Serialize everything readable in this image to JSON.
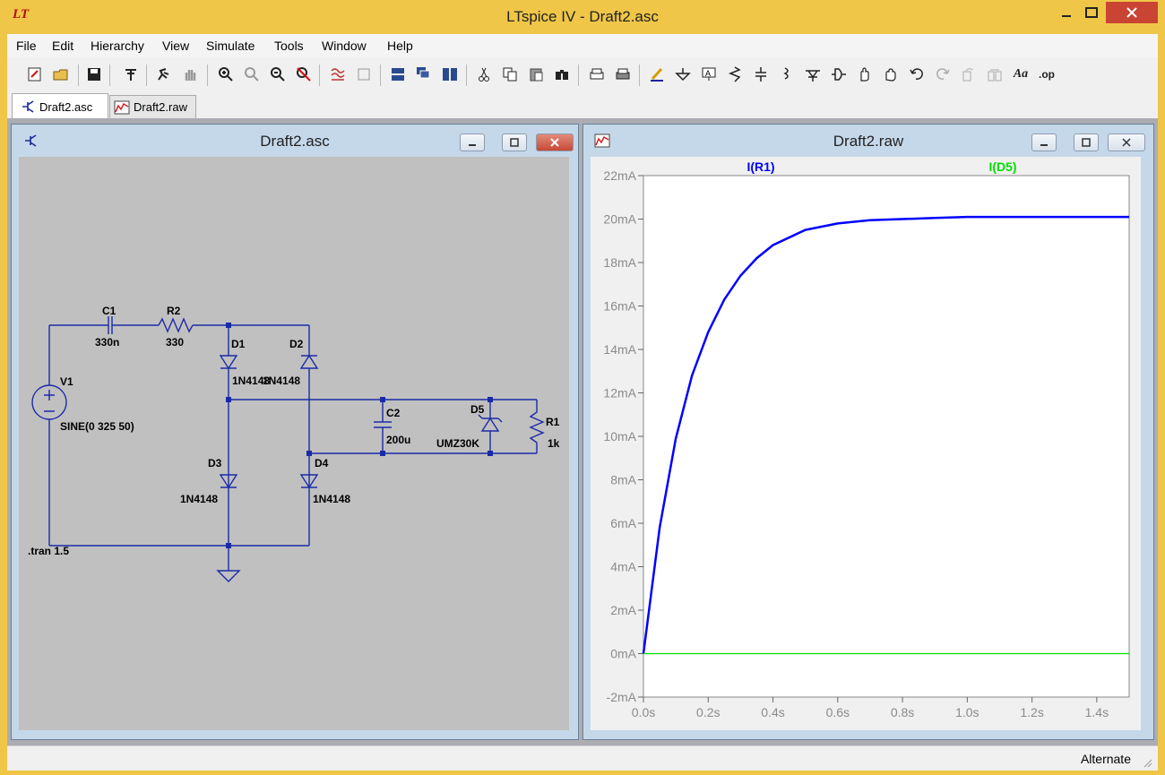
{
  "window": {
    "title": "LTspice IV - Draft2.asc",
    "app_icon": "LT"
  },
  "menu": [
    "File",
    "Edit",
    "Hierarchy",
    "View",
    "Simulate",
    "Tools",
    "Window",
    "Help"
  ],
  "toolbar_icons": [
    "new-schematic-icon",
    "open-icon",
    "save-icon",
    "control-panel-icon",
    "run-icon",
    "halt-icon",
    "zoom-in-icon",
    "zoom-full-icon",
    "zoom-out-icon",
    "zoom-cancel-icon",
    "autorange-icon",
    "undo-zoom-icon",
    "tile-horizontal-icon",
    "cascade-icon",
    "tile-vertical-icon",
    "cut-icon",
    "copy-icon",
    "paste-icon",
    "find-icon",
    "print-preview-icon",
    "print-icon",
    "draw-wire-icon",
    "ground-icon",
    "label-net-icon",
    "resistor-icon",
    "capacitor-icon",
    "inductor-icon",
    "diode-icon",
    "component-icon",
    "move-icon",
    "drag-icon",
    "undo-icon",
    "redo-icon",
    "rotate-icon",
    "mirror-icon",
    "text-icon",
    "spice-directive-icon"
  ],
  "toolbar_text": {
    "text_tool": "Aa",
    "spice_directive": ".op"
  },
  "tabs": [
    {
      "label": "Draft2.asc"
    },
    {
      "label": "Draft2.raw"
    }
  ],
  "schematic_window": {
    "title": "Draft2.asc",
    "labels": {
      "c1_name": "C1",
      "c1_value": "330n",
      "r2_name": "R2",
      "r2_value": "330",
      "d1_name": "D1",
      "d1_model": "1N4148",
      "d2_name": "D2",
      "d2_model": "1N4148",
      "d3_name": "D3",
      "d3_model": "1N4148",
      "d4_name": "D4",
      "d4_model": "1N4148",
      "v1_name": "V1",
      "v1_value": "SINE(0 325 50)",
      "c2_name": "C2",
      "c2_value": "200u",
      "d5_name": "D5",
      "d5_model": "UMZ30K",
      "r1_name": "R1",
      "r1_value": "1k",
      "directive": ".tran 1.5"
    }
  },
  "waveform_window": {
    "title": "Draft2.raw"
  },
  "chart_data": {
    "type": "line",
    "xlim": [
      0,
      1.5
    ],
    "ylim": [
      -2,
      22
    ],
    "x_ticks": [
      "0.0s",
      "0.2s",
      "0.4s",
      "0.6s",
      "0.8s",
      "1.0s",
      "1.2s",
      "1.4s"
    ],
    "y_ticks": [
      "-2mA",
      "0mA",
      "2mA",
      "4mA",
      "6mA",
      "8mA",
      "10mA",
      "12mA",
      "14mA",
      "16mA",
      "18mA",
      "20mA",
      "22mA"
    ],
    "series": [
      {
        "name": "I(R1)",
        "color": "#0000ff",
        "x": [
          0,
          0.05,
          0.1,
          0.15,
          0.2,
          0.25,
          0.3,
          0.35,
          0.4,
          0.5,
          0.6,
          0.7,
          0.8,
          0.9,
          1.0,
          1.1,
          1.2,
          1.3,
          1.4,
          1.5
        ],
        "y": [
          0,
          5.8,
          9.9,
          12.8,
          14.8,
          16.3,
          17.4,
          18.2,
          18.8,
          19.5,
          19.8,
          19.95,
          20.0,
          20.05,
          20.1,
          20.1,
          20.1,
          20.1,
          20.1,
          20.1
        ]
      },
      {
        "name": "I(D5)",
        "color": "#00e000",
        "x": [
          0,
          1.5
        ],
        "y": [
          0,
          0
        ]
      }
    ]
  },
  "status": {
    "mode": "Alternate"
  }
}
